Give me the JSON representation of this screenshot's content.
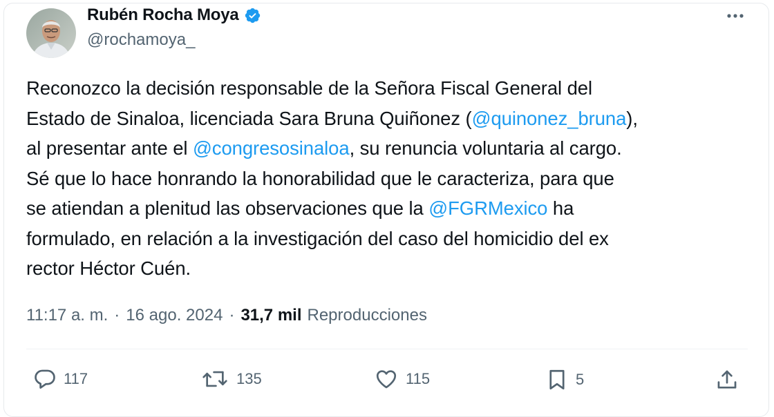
{
  "author": {
    "display_name": "Rubén Rocha Moya",
    "handle": "@rochamoya_",
    "verified": true,
    "verified_color": "#1d9bf0"
  },
  "tweet": {
    "lines": [
      [
        {
          "t": "Reconozco la decisión responsable de la Señora Fiscal General del"
        }
      ],
      [
        {
          "t": "Estado de Sinaloa, licenciada Sara Bruna Quiñonez ("
        },
        {
          "t": "@quinonez_bruna",
          "mention": true
        },
        {
          "t": "),"
        }
      ],
      [
        {
          "t": "al presentar ante el "
        },
        {
          "t": "@congresosinaloa",
          "mention": true
        },
        {
          "t": ", su renuncia voluntaria al cargo."
        }
      ],
      [
        {
          "t": "Sé que lo hace honrando la  honorabilidad que le caracteriza, para que"
        }
      ],
      [
        {
          "t": "se atiendan a plenitud las observaciones que la "
        },
        {
          "t": "@FGRMexico",
          "mention": true
        },
        {
          "t": " ha"
        }
      ],
      [
        {
          "t": "formulado, en relación a la investigación del caso del homicidio del ex"
        }
      ],
      [
        {
          "t": "rector Héctor Cuén."
        }
      ]
    ],
    "mention_color": "#1d9bf0"
  },
  "meta": {
    "time": "11:17 a. m.",
    "separator": "·",
    "date": "16 ago. 2024",
    "views_count": "31,7 mil",
    "views_label": "Reproducciones"
  },
  "actions": {
    "replies": "117",
    "reposts": "135",
    "likes": "115",
    "bookmarks": "5"
  },
  "icons": [
    "verified-badge-icon",
    "more-options-icon",
    "reply-icon",
    "repost-icon",
    "like-icon",
    "bookmark-icon",
    "share-icon"
  ]
}
